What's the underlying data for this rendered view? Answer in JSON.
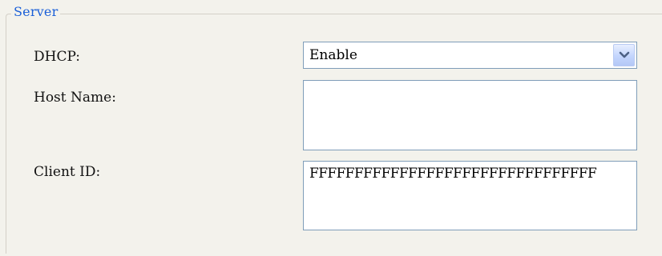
{
  "server_group": {
    "title": "Server",
    "dhcp": {
      "label": "DHCP:",
      "selected": "Enable"
    },
    "host_name": {
      "label": "Host Name:",
      "value": ""
    },
    "client_id": {
      "label": "Client ID:",
      "value": "FFFFFFFFFFFFFFFFFFFFFFFFFFFFFFFF"
    }
  },
  "icons": {
    "dropdown_arrow": "chevron-down-icon"
  },
  "colors": {
    "legend_text": "#1a5fd8",
    "field_border": "#7f9db9",
    "background": "#f3f2ec"
  }
}
